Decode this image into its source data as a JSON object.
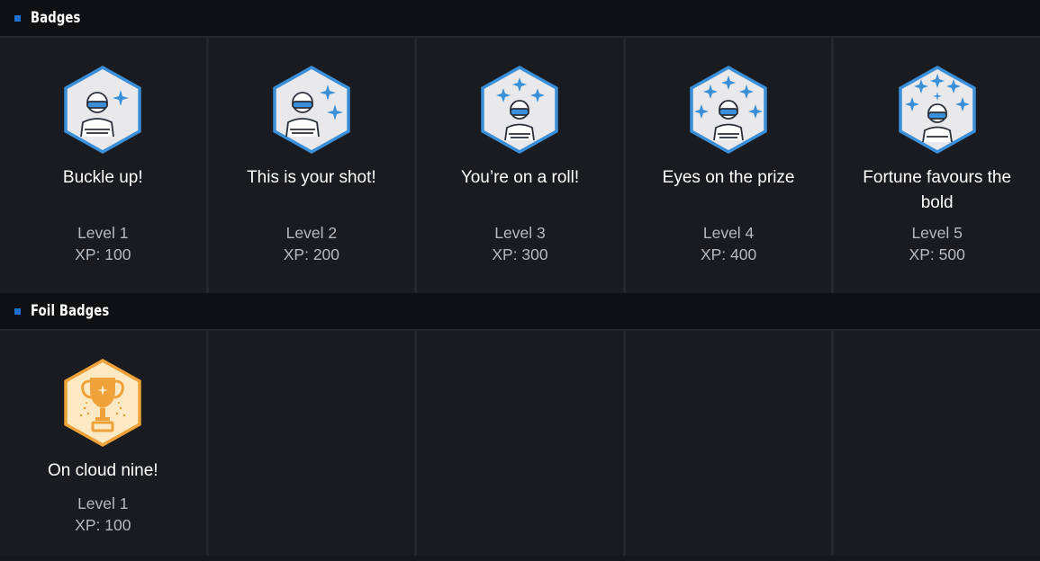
{
  "sections": {
    "badges": {
      "title": "Badges",
      "items": [
        {
          "name": "Buckle up!",
          "level": "Level 1",
          "xp": "XP: 100",
          "icon": "driver-sparkle-icon"
        },
        {
          "name": "This is your shot!",
          "level": "Level 2",
          "xp": "XP: 200",
          "icon": "driver-sparkle-icon"
        },
        {
          "name": "You’re on a roll!",
          "level": "Level 3",
          "xp": "XP: 300",
          "icon": "driver-sparkle-icon"
        },
        {
          "name": "Eyes on the prize",
          "level": "Level 4",
          "xp": "XP: 400",
          "icon": "driver-sparkle-icon"
        },
        {
          "name": "Fortune favours the bold",
          "level": "Level 5",
          "xp": "XP: 500",
          "icon": "driver-sparkle-icon"
        }
      ]
    },
    "foil": {
      "title": "Foil Badges",
      "items": [
        {
          "name": "On cloud nine!",
          "level": "Level 1",
          "xp": "XP: 100",
          "icon": "trophy-icon"
        }
      ]
    }
  },
  "colors": {
    "accent": "#1f6fd1",
    "badge_blue": "#3a8fd8",
    "badge_fill": "#e9e9eb",
    "foil_orange": "#f0a23a",
    "foil_fill": "#fde9c4"
  }
}
